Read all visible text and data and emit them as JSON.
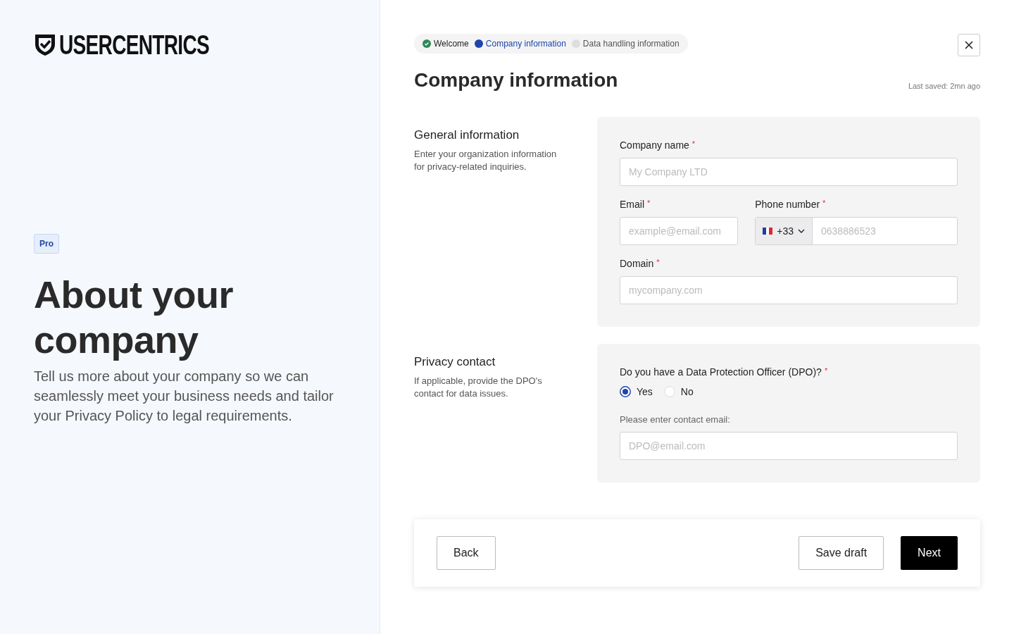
{
  "brand": {
    "name": "USERCENTRICS"
  },
  "intro": {
    "badge": "Pro",
    "title": "About your company",
    "description": "Tell us more about your company so we can seamlessly meet your business needs and tailor your Privacy Policy to legal requirements."
  },
  "steps": [
    {
      "label": "Welcome",
      "kind": "done"
    },
    {
      "label": "Company information",
      "kind": "current"
    },
    {
      "label": "Data handling information",
      "kind": "upcoming"
    }
  ],
  "page": {
    "title": "Company information",
    "last_saved": "Last saved: 2mn ago"
  },
  "sections": [
    {
      "title": "General information",
      "description": "Enter your organization information for privacy-related inquiries.",
      "rows": [
        [
          {
            "kind": "text",
            "label": "Company name",
            "mark": "*",
            "placeholder": "My Company LTD"
          }
        ],
        [
          {
            "kind": "text",
            "label": "Email",
            "mark": "*",
            "placeholder": "example@email.com"
          },
          {
            "kind": "phone",
            "label": "Phone number",
            "mark": "*",
            "country_code": "+33",
            "placeholder": "0638886523"
          }
        ],
        [
          {
            "kind": "text",
            "label": "Domain",
            "mark": "*",
            "placeholder": "mycompany.com"
          }
        ]
      ]
    },
    {
      "title": "Privacy contact",
      "description": "If applicable, provide the DPO's contact for data issues.",
      "rows": [
        [
          {
            "kind": "radio",
            "label": "Do you have a Data Protection Officer (DPO)?",
            "mark": "*",
            "options": [
              {
                "label": "Yes",
                "selected": true
              },
              {
                "label": "No",
                "selected": false
              }
            ]
          }
        ],
        [
          {
            "kind": "text",
            "label": "Please enter contact email:",
            "placeholder": "DPO@email.com",
            "muted_label": true
          }
        ]
      ]
    }
  ],
  "footer": {
    "back": "Back",
    "save": "Save draft",
    "next": "Next"
  }
}
